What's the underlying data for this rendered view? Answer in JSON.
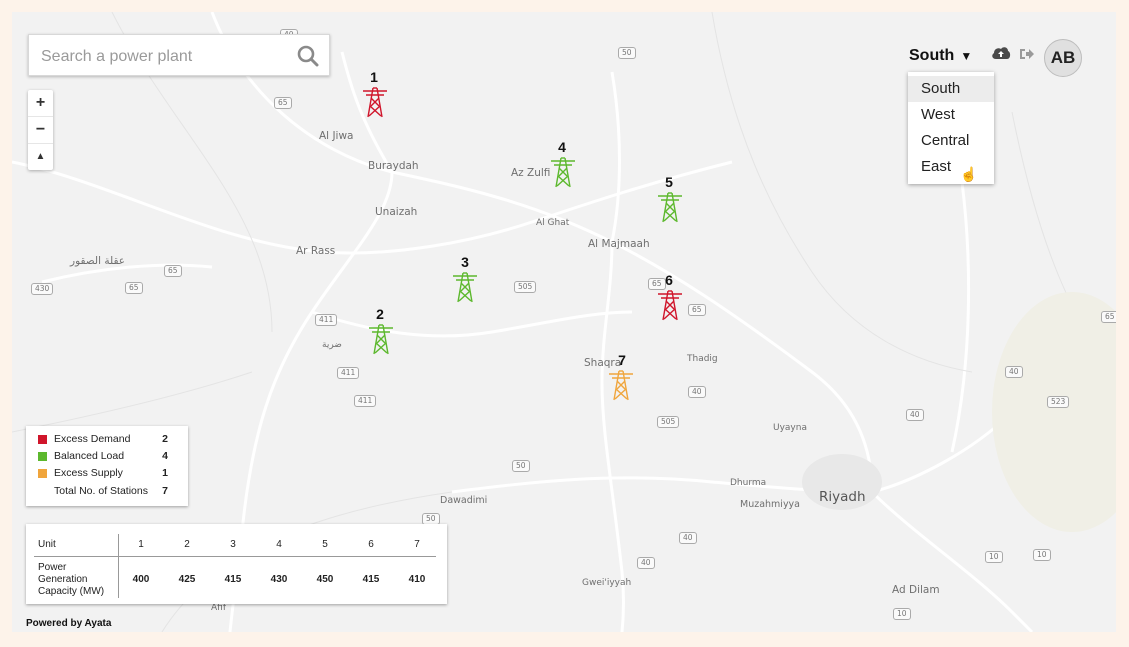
{
  "search": {
    "placeholder": "Search a power plant",
    "icon": "search-icon"
  },
  "zoom": {
    "in_label": "+",
    "out_label": "−",
    "compass_label": "▲"
  },
  "header": {
    "region_selected": "South",
    "region_options": [
      "South",
      "West",
      "Central",
      "East"
    ],
    "avatar_initials": "AB"
  },
  "places": [
    "Al Jiwa",
    "Buraydah",
    "Az Zulfi",
    "Unaizah",
    "Al Ghat",
    "Al Majmaah",
    "Ar Rass",
    "عقلة الصقور",
    "Shaqra",
    "Thadig",
    "ضرية",
    "Uyayna",
    "Dhurma",
    "Muzahmiyya",
    "Riyadh",
    "Dawadimi",
    "Gwei'iyyah",
    "Ad Dilam",
    "Afif"
  ],
  "road_shields": [
    "65",
    "50",
    "65",
    "65",
    "430",
    "65",
    "505",
    "411",
    "411",
    "411",
    "65",
    "65",
    "40",
    "505",
    "40",
    "523",
    "40",
    "50",
    "50",
    "40",
    "40",
    "10",
    "10",
    "10",
    "40"
  ],
  "stations": [
    {
      "id": "1",
      "status": "excess-demand"
    },
    {
      "id": "2",
      "status": "balanced"
    },
    {
      "id": "3",
      "status": "balanced"
    },
    {
      "id": "4",
      "status": "balanced"
    },
    {
      "id": "5",
      "status": "balanced"
    },
    {
      "id": "6",
      "status": "excess-demand"
    },
    {
      "id": "7",
      "status": "excess-supply"
    }
  ],
  "colors": {
    "excess_demand": "#d0152b",
    "balanced": "#5cb82d",
    "excess_supply": "#f0a53c"
  },
  "legend": {
    "excess_demand_label": "Excess Demand",
    "excess_demand_count": "2",
    "balanced_label": "Balanced Load",
    "balanced_count": "4",
    "excess_supply_label": "Excess Supply",
    "excess_supply_count": "1",
    "total_label": "Total No. of Stations",
    "total_count": "7"
  },
  "unit_table": {
    "header_label": "Unit",
    "row_label": "Power Generation Capacity (MW)",
    "units": [
      "1",
      "2",
      "3",
      "4",
      "5",
      "6",
      "7"
    ],
    "capacities": [
      "400",
      "425",
      "415",
      "430",
      "450",
      "415",
      "410"
    ]
  },
  "footer": {
    "powered_by": "Powered by Ayata"
  }
}
